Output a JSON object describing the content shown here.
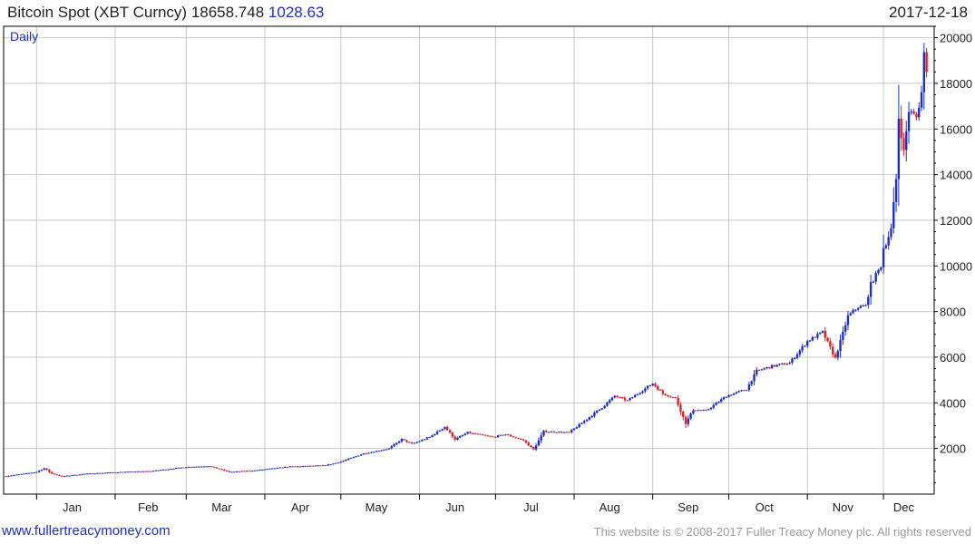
{
  "header": {
    "title": "Bitcoin Spot (XBT Curncy) 18658.748",
    "change": "1028.63",
    "date": "2017-12-18"
  },
  "footer": {
    "site": "www.fullertreacymoney.com",
    "copyright": "This website is © 2008-2017 Fuller Treacy Money plc. All rights reserved"
  },
  "colors": {
    "up": "#1f2fbf",
    "down": "#d8232a",
    "grid": "#c8c8c8",
    "axis": "#000000"
  },
  "chart_data": {
    "type": "candlestick",
    "period": "Daily",
    "x_start": "2016-12-20",
    "x_end": "2017-12-18",
    "xlim": [
      "2016-12-19",
      "2017-12-21"
    ],
    "ylim": [
      0,
      20500
    ],
    "y_ticks": [
      2000,
      4000,
      6000,
      8000,
      10000,
      12000,
      14000,
      16000,
      18000,
      20000
    ],
    "y_axis_side": "right",
    "grid": true,
    "month_labels": [
      {
        "label": "Jan",
        "date": "2017-01-15"
      },
      {
        "label": "Feb",
        "date": "2017-02-14"
      },
      {
        "label": "Mar",
        "date": "2017-03-15"
      },
      {
        "label": "Apr",
        "date": "2017-04-15"
      },
      {
        "label": "May",
        "date": "2017-05-15"
      },
      {
        "label": "Jun",
        "date": "2017-06-15"
      },
      {
        "label": "Jul",
        "date": "2017-07-15"
      },
      {
        "label": "Aug",
        "date": "2017-08-15"
      },
      {
        "label": "Sep",
        "date": "2017-09-15"
      },
      {
        "label": "Oct",
        "date": "2017-10-15"
      },
      {
        "label": "Nov",
        "date": "2017-11-15"
      },
      {
        "label": "Dec",
        "date": "2017-12-09"
      }
    ],
    "close_path": [
      [
        "2016-12-20",
        790
      ],
      [
        "2017-01-01",
        970
      ],
      [
        "2017-01-04",
        1130
      ],
      [
        "2017-01-07",
        900
      ],
      [
        "2017-01-11",
        780
      ],
      [
        "2017-01-20",
        890
      ],
      [
        "2017-02-01",
        960
      ],
      [
        "2017-02-15",
        1010
      ],
      [
        "2017-03-01",
        1190
      ],
      [
        "2017-03-10",
        1230
      ],
      [
        "2017-03-18",
        970
      ],
      [
        "2017-03-28",
        1040
      ],
      [
        "2017-04-10",
        1200
      ],
      [
        "2017-04-25",
        1260
      ],
      [
        "2017-05-01",
        1420
      ],
      [
        "2017-05-10",
        1780
      ],
      [
        "2017-05-20",
        2000
      ],
      [
        "2017-05-25",
        2400
      ],
      [
        "2017-05-29",
        2200
      ],
      [
        "2017-06-05",
        2500
      ],
      [
        "2017-06-11",
        2950
      ],
      [
        "2017-06-15",
        2400
      ],
      [
        "2017-06-20",
        2700
      ],
      [
        "2017-06-30",
        2500
      ],
      [
        "2017-07-05",
        2620
      ],
      [
        "2017-07-12",
        2350
      ],
      [
        "2017-07-16",
        1950
      ],
      [
        "2017-07-20",
        2750
      ],
      [
        "2017-07-30",
        2700
      ],
      [
        "2017-08-05",
        3200
      ],
      [
        "2017-08-12",
        3800
      ],
      [
        "2017-08-17",
        4300
      ],
      [
        "2017-08-22",
        4100
      ],
      [
        "2017-09-01",
        4850
      ],
      [
        "2017-09-05",
        4400
      ],
      [
        "2017-09-10",
        4200
      ],
      [
        "2017-09-14",
        3100
      ],
      [
        "2017-09-17",
        3700
      ],
      [
        "2017-09-22",
        3650
      ],
      [
        "2017-09-30",
        4300
      ],
      [
        "2017-10-08",
        4600
      ],
      [
        "2017-10-12",
        5400
      ],
      [
        "2017-10-18",
        5600
      ],
      [
        "2017-10-25",
        5750
      ],
      [
        "2017-11-01",
        6700
      ],
      [
        "2017-11-07",
        7100
      ],
      [
        "2017-11-12",
        5950
      ],
      [
        "2017-11-17",
        7800
      ],
      [
        "2017-11-21",
        8200
      ],
      [
        "2017-11-24",
        8250
      ],
      [
        "2017-11-26",
        9200
      ],
      [
        "2017-11-30",
        10000
      ],
      [
        "2017-12-01",
        10800
      ],
      [
        "2017-12-02",
        11000
      ],
      [
        "2017-12-04",
        11600
      ],
      [
        "2017-12-06",
        13800
      ],
      [
        "2017-12-07",
        16500
      ],
      [
        "2017-12-09",
        15000
      ],
      [
        "2017-12-11",
        16800
      ],
      [
        "2017-12-14",
        16500
      ],
      [
        "2017-12-16",
        17600
      ],
      [
        "2017-12-17",
        19300
      ],
      [
        "2017-12-18",
        18658
      ]
    ]
  }
}
